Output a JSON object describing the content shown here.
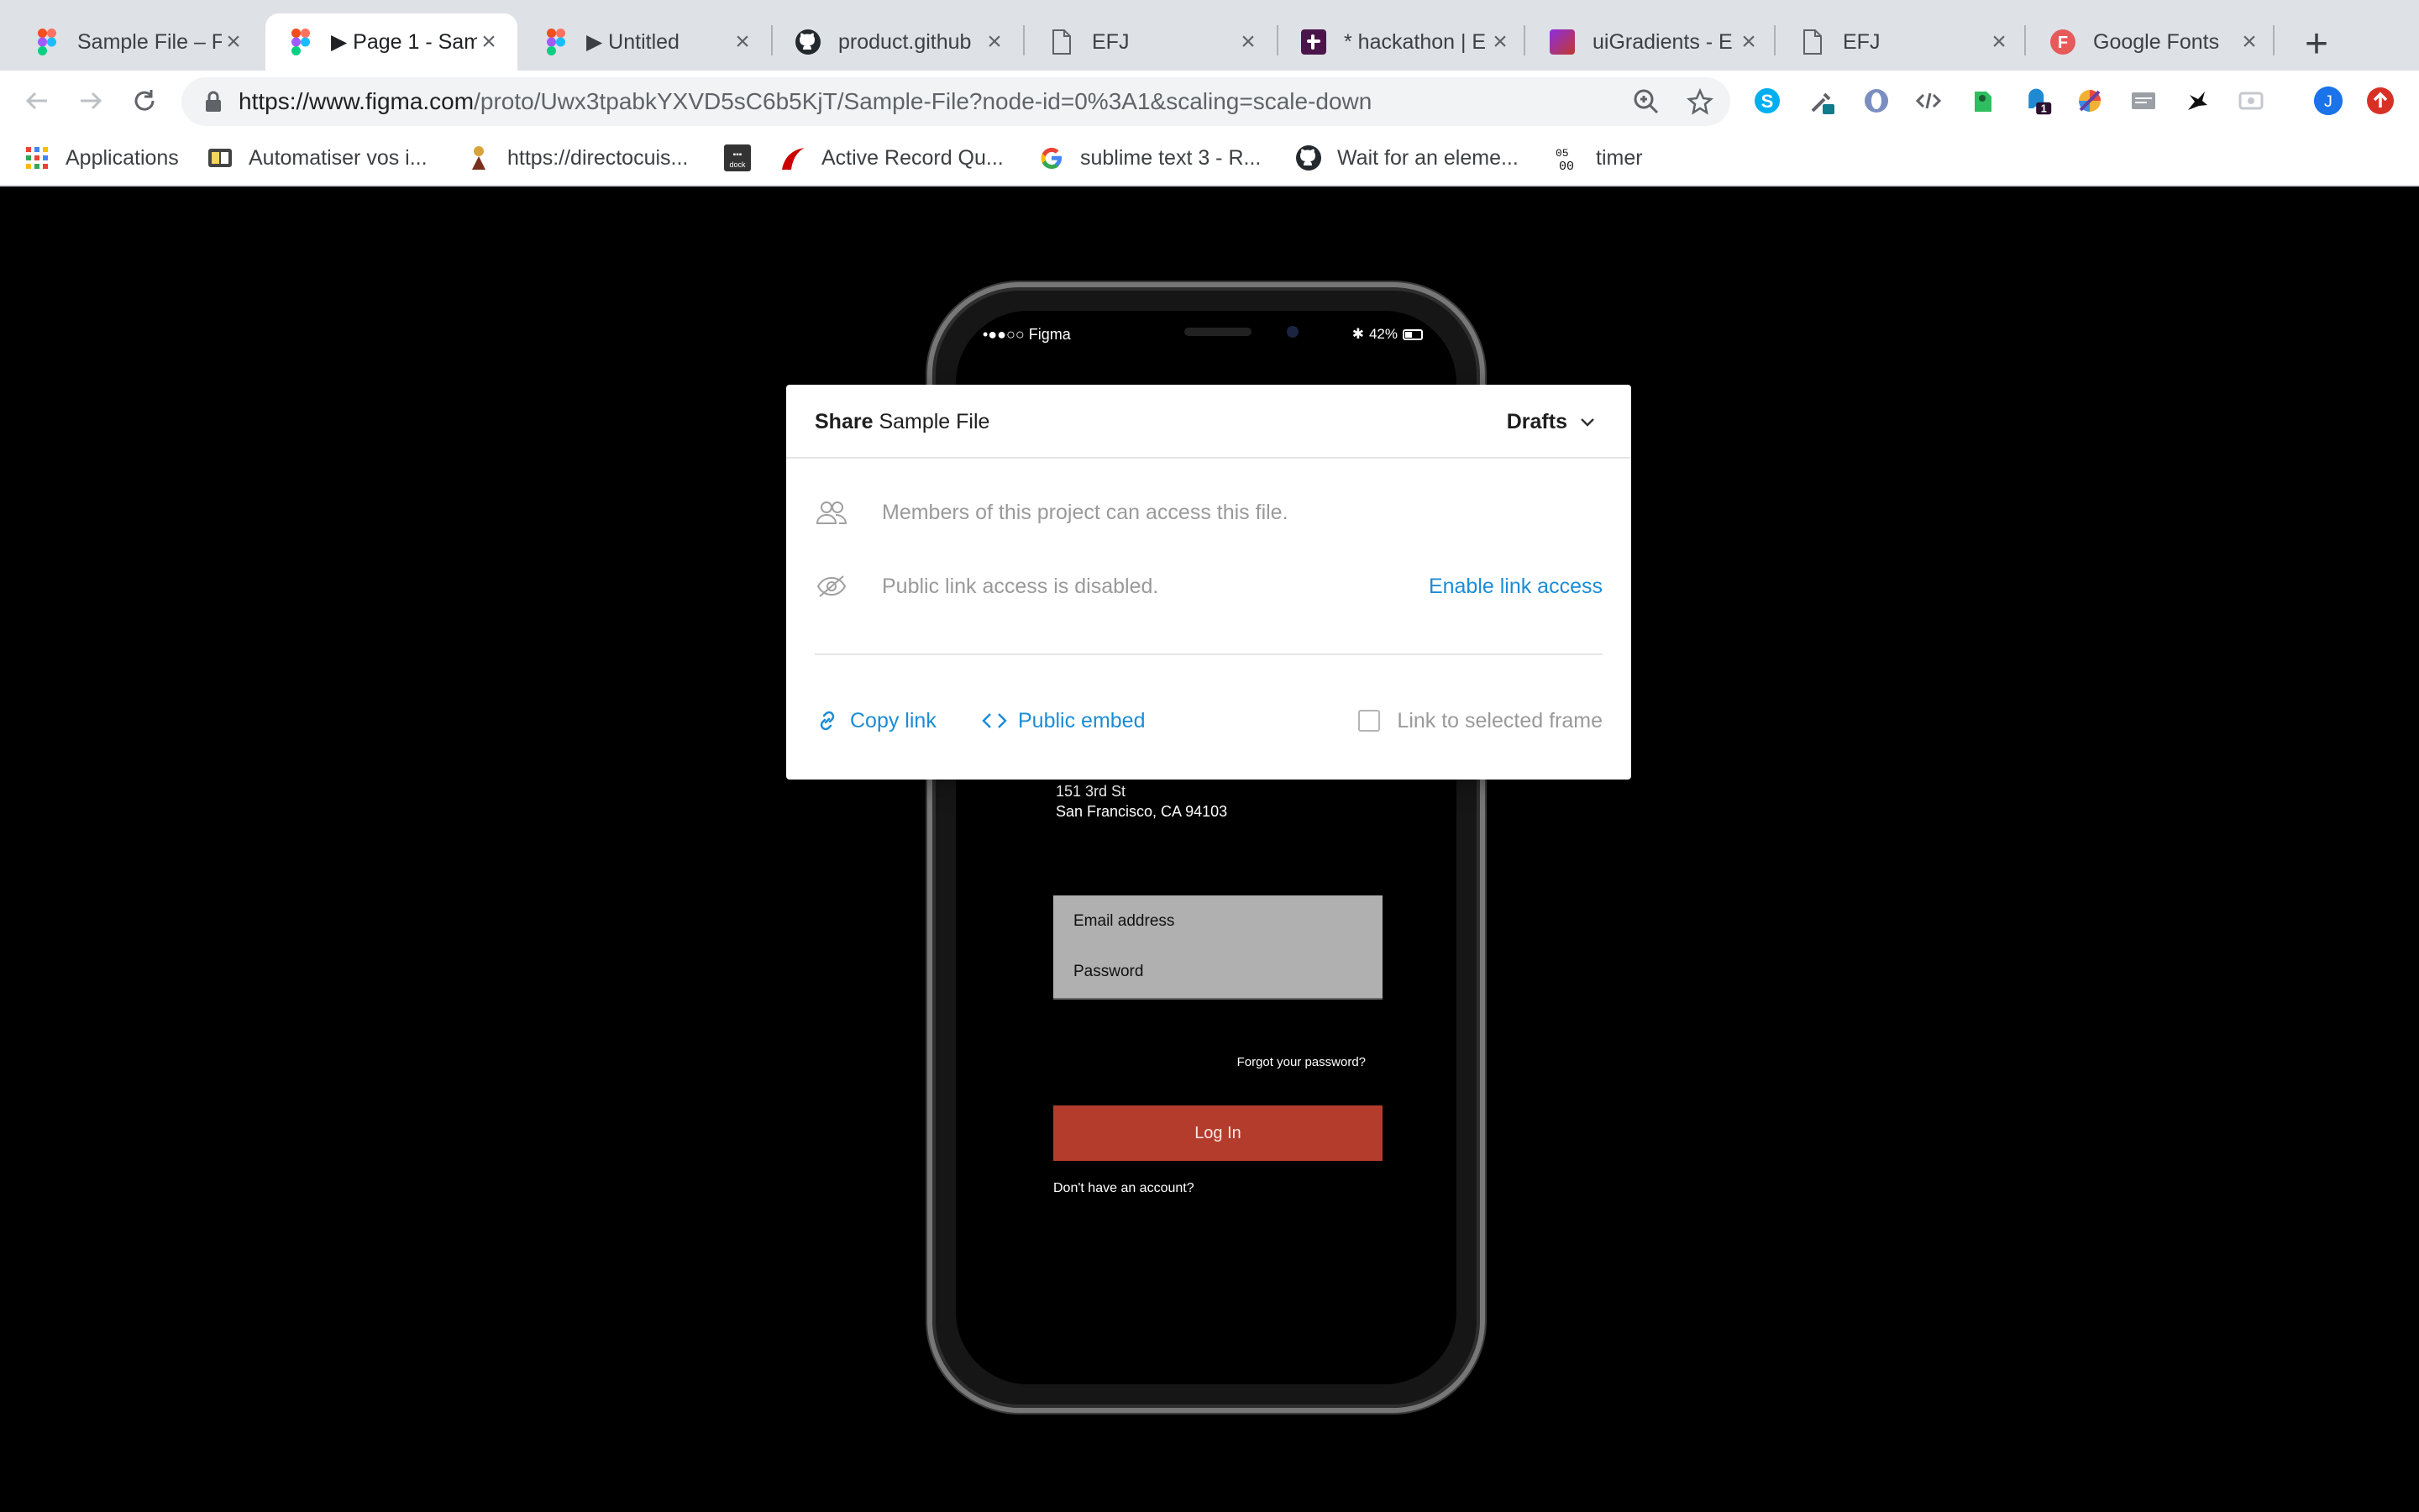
{
  "tabs": [
    {
      "title": "Sample File – F",
      "icon": "figma-icon",
      "active": false
    },
    {
      "title": "▶ Page 1 - Sam",
      "icon": "figma-icon",
      "active": true
    },
    {
      "title": "▶ Untitled",
      "icon": "figma-icon",
      "active": false
    },
    {
      "title": "product.github",
      "icon": "github-icon",
      "active": false
    },
    {
      "title": "EFJ",
      "icon": "document-icon",
      "active": false
    },
    {
      "title": "* hackathon | E",
      "icon": "slack-icon",
      "active": false
    },
    {
      "title": "uiGradients - E",
      "icon": "gradient-icon",
      "active": false
    },
    {
      "title": "EFJ",
      "icon": "document-icon",
      "active": false
    },
    {
      "title": "Google Fonts",
      "icon": "google-fonts-icon",
      "active": false
    }
  ],
  "address_bar": {
    "host": "https://www.figma.com",
    "path": "/proto/Uwx3tpabkYXVD5sC6b5KjT/Sample-File?node-id=0%3A1&scaling=scale-down"
  },
  "profile_initial": "J",
  "extension_badge": "1",
  "bookmarks": [
    {
      "label": "Applications",
      "icon": "apps-grid-icon"
    },
    {
      "label": "Automatiser vos i...",
      "icon": "book-icon"
    },
    {
      "label": "https://directocuis...",
      "icon": "chef-icon"
    },
    {
      "label": "",
      "icon": "devdocs-icon"
    },
    {
      "label": "Active Record Qu...",
      "icon": "rails-icon"
    },
    {
      "label": "sublime text 3 - R...",
      "icon": "google-icon"
    },
    {
      "label": "Wait for an eleme...",
      "icon": "github-icon"
    },
    {
      "label": "timer",
      "icon": "timer-icon"
    }
  ],
  "phone": {
    "carrier": "•●●○○ Figma",
    "battery": "42%",
    "address_line1": "151 3rd St",
    "address_line2": "San Francisco, CA 94103",
    "email_placeholder": "Email address",
    "password_placeholder": "Password",
    "forgot": "Forgot your password?",
    "login": "Log In",
    "no_account": "Don't have an account?"
  },
  "dialog": {
    "title_bold": "Share",
    "title_file": "Sample File",
    "location": "Drafts",
    "members_text": "Members of this project can access this file.",
    "public_text": "Public link access is disabled.",
    "enable_link": "Enable link access",
    "copy_link": "Copy link",
    "public_embed": "Public embed",
    "link_to_frame": "Link to selected frame",
    "link_to_frame_checked": false
  },
  "colors": {
    "link_blue": "#1b8cd6",
    "login_red": "#b43c2d"
  }
}
